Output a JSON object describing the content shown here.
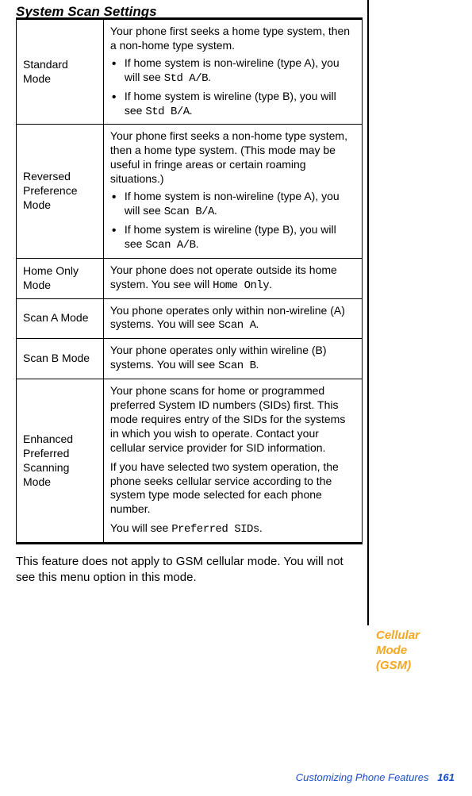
{
  "heading": "System Scan Settings",
  "rows": [
    {
      "mode": "Standard Mode",
      "intro": "Your phone first seeks a home type system, then a non-home type system.",
      "bullets": [
        {
          "lead": "If home system is non-wireline (type A), you will see ",
          "code": "Std A/B",
          "tail": "."
        },
        {
          "lead": "If home system is wireline (type B), you will see ",
          "code": "Std B/A",
          "tail": "."
        }
      ]
    },
    {
      "mode": "Reversed Preference Mode",
      "intro": "Your phone first seeks a non-home type system, then a home type system. (This mode may be useful in fringe areas or certain roaming situations.)",
      "bullets": [
        {
          "lead": "If home system is non-wireline (type A), you will see ",
          "code": "Scan B/A",
          "tail": "."
        },
        {
          "lead": "If home system is wireline (type B), you will see ",
          "code": "Scan A/B",
          "tail": "."
        }
      ]
    },
    {
      "mode": "Home Only Mode",
      "intro_lead": "Your phone does not operate outside its home system. You see will ",
      "intro_code": "Home Only",
      "intro_tail": "."
    },
    {
      "mode": "Scan A Mode",
      "intro_lead": "You phone operates only within non-wireline (A) systems. You will see ",
      "intro_code": "Scan A",
      "intro_tail": "."
    },
    {
      "mode": "Scan B Mode",
      "intro_lead": "Your phone operates only within wireline (B) systems. You will see ",
      "intro_code": "Scan B",
      "intro_tail": "."
    },
    {
      "mode": "Enhanced Preferred Scanning Mode",
      "p1": "Your phone scans for home or programmed preferred System ID numbers (SIDs) first. This mode requires entry of the SIDs for the systems in which you wish to operate. Contact your cellular service provider for SID information.",
      "p2": "If you have selected two system operation, the phone seeks cellular service according to the system type mode selected for each phone number.",
      "p3_lead": "You will see ",
      "p3_code": "Preferred SIDs",
      "p3_tail": "."
    }
  ],
  "note": "This feature does not apply to GSM cellular mode. You will not see this menu option in this mode.",
  "side_label_l1": "Cellular",
  "side_label_l2": "Mode",
  "side_label_l3": "(GSM)",
  "footer_text": "Customizing Phone Features",
  "footer_page": "161"
}
